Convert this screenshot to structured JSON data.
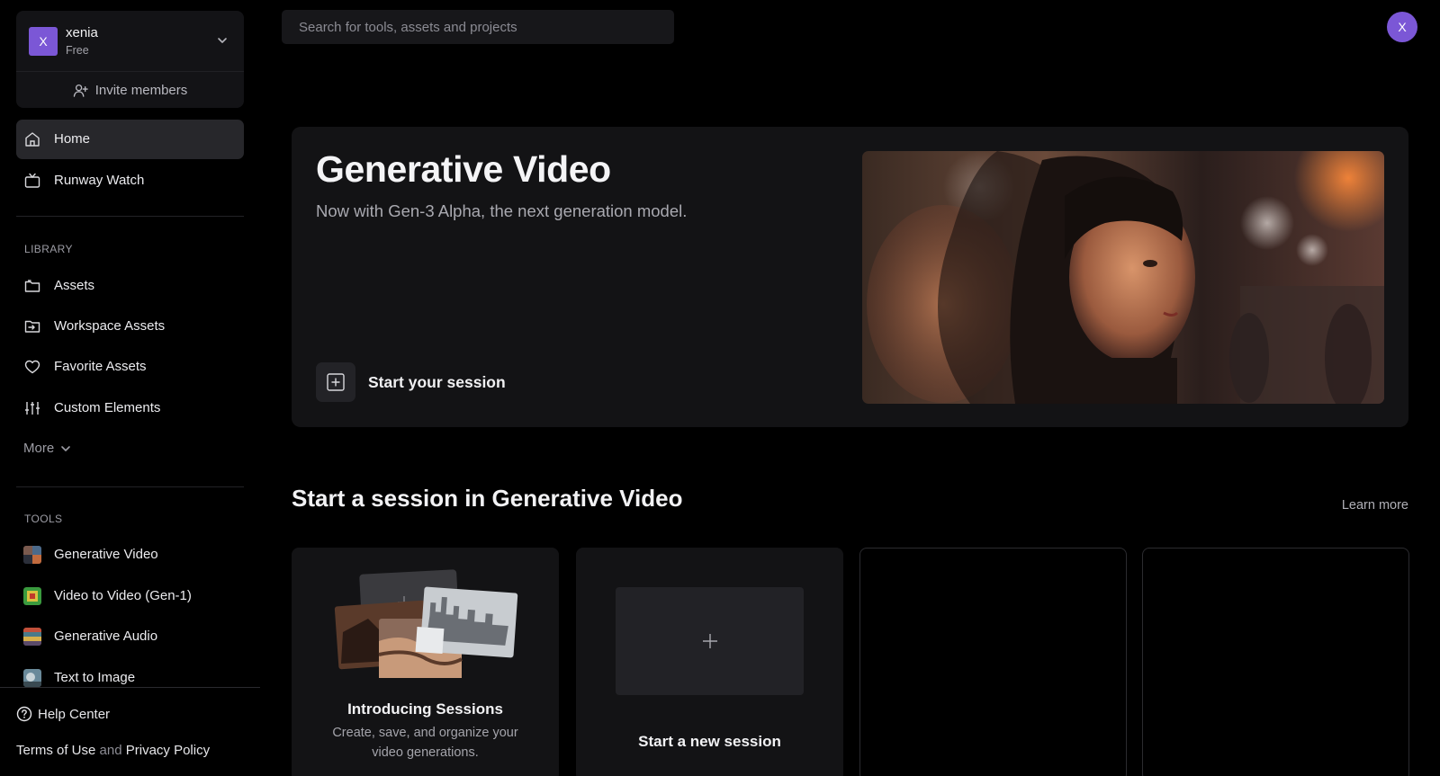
{
  "account": {
    "avatar_letter": "X",
    "name": "xenia",
    "plan": "Free",
    "invite_label": "Invite members"
  },
  "nav": {
    "home": "Home",
    "runway_watch": "Runway Watch"
  },
  "library": {
    "heading": "LIBRARY",
    "items": [
      {
        "label": "Assets",
        "icon": "folder-icon"
      },
      {
        "label": "Workspace Assets",
        "icon": "folder-import-icon"
      },
      {
        "label": "Favorite Assets",
        "icon": "heart-icon"
      },
      {
        "label": "Custom Elements",
        "icon": "sliders-icon"
      }
    ],
    "more_label": "More"
  },
  "tools": {
    "heading": "TOOLS",
    "items": [
      {
        "label": "Generative Video"
      },
      {
        "label": "Video to Video (Gen-1)"
      },
      {
        "label": "Generative Audio"
      },
      {
        "label": "Text to Image"
      }
    ]
  },
  "footer": {
    "help_center": "Help Center",
    "terms": "Terms of Use",
    "and": "and",
    "privacy": "Privacy Policy"
  },
  "topbar": {
    "search_placeholder": "Search for tools, assets and projects",
    "user_avatar_letter": "X"
  },
  "hero": {
    "title": "Generative Video",
    "subtitle": "Now with Gen-3 Alpha, the next generation model.",
    "cta": "Start your session"
  },
  "sessions": {
    "title": "Start a session in Generative Video",
    "learn_more": "Learn more",
    "intro_title": "Introducing Sessions",
    "intro_desc_line1": "Create, save, and organize your",
    "intro_desc_line2": "video generations.",
    "new_session": "Start a new session"
  },
  "colors": {
    "accent_purple": "#7b57d6",
    "background": "#000000",
    "panel": "#131315"
  }
}
